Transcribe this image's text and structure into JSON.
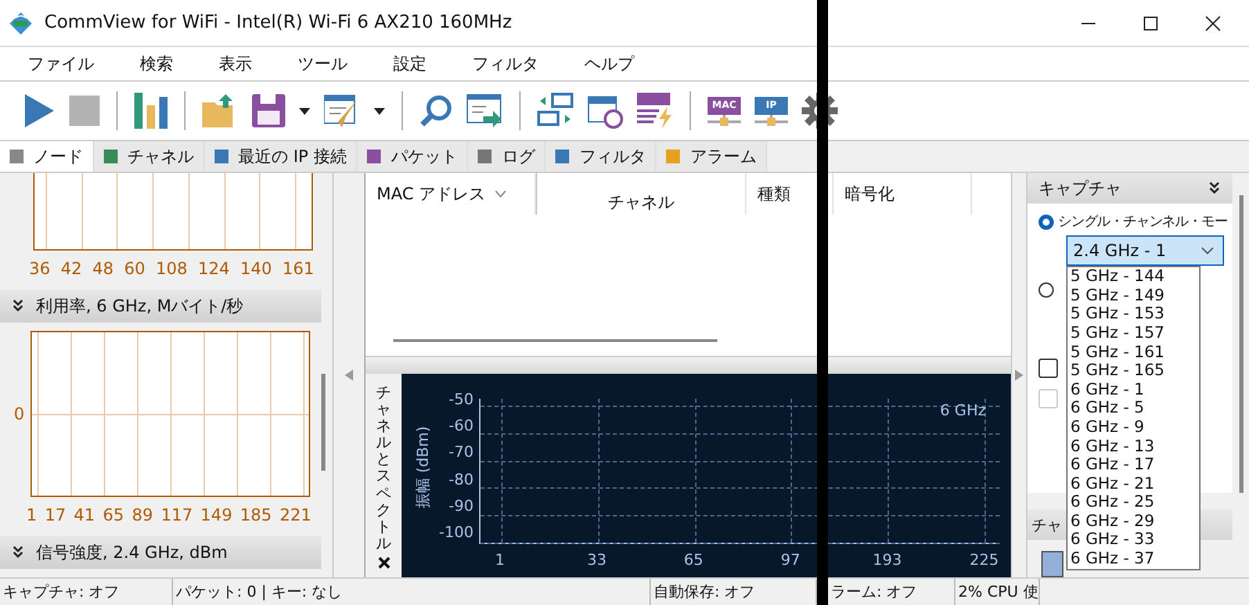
{
  "window": {
    "title": "CommView for WiFi - Intel(R) Wi-Fi 6 AX210 160MHz"
  },
  "menu": [
    "ファイル",
    "検索",
    "表示",
    "ツール",
    "設定",
    "フィルタ",
    "ヘルプ"
  ],
  "toolbar": {
    "mac_label": "MAC",
    "ip_label": "IP"
  },
  "tabs": [
    {
      "label": "ノード",
      "selected": true
    },
    {
      "label": "チャネル",
      "selected": false
    },
    {
      "label": "最近の IP 接続",
      "selected": false
    },
    {
      "label": "パケット",
      "selected": false
    },
    {
      "label": "ログ",
      "selected": false
    },
    {
      "label": "フィルタ",
      "selected": false
    },
    {
      "label": "アラーム",
      "selected": false
    }
  ],
  "left_panel": {
    "top_chart": {
      "x_ticks": [
        "36",
        "42",
        "48",
        "60",
        "108",
        "124",
        "140",
        "161"
      ]
    },
    "sections": [
      {
        "title": "利用率, 6 GHz, Mバイト/秒",
        "y_tick": "0",
        "x_ticks": [
          "1",
          "17",
          "41",
          "65",
          "89",
          "117",
          "149",
          "185",
          "221"
        ]
      },
      {
        "title": "信号強度, 2.4 GHz, dBm"
      }
    ]
  },
  "nodes_table": {
    "columns": [
      {
        "label": "MAC アドレス",
        "sorted": true
      },
      {
        "label": "チャネル",
        "sorted": false
      },
      {
        "label": "種類",
        "sorted": false
      },
      {
        "label": "暗号化",
        "sorted": false
      }
    ]
  },
  "spectrum": {
    "panel_title": "チャネルとスペクトル",
    "ylabel": "振幅 (dBm)",
    "y_ticks": [
      "-50",
      "-60",
      "-70",
      "-80",
      "-90",
      "-100"
    ],
    "x_ticks": [
      "1",
      "33",
      "65",
      "97",
      "193",
      "225"
    ],
    "band_label": "6 GHz"
  },
  "capture_panel": {
    "title": "キャプチャ",
    "modes": [
      {
        "label": "シングル・チャンネル・モー",
        "selected": true
      },
      {
        "selected": false
      }
    ],
    "channel_select": {
      "value": "2.4 GHz - 1",
      "expanded": true,
      "options": [
        "5 GHz - 144",
        "5 GHz - 149",
        "5 GHz - 153",
        "5 GHz - 157",
        "5 GHz - 161",
        "5 GHz - 165",
        "6 GHz - 1",
        "6 GHz - 5",
        "6 GHz - 9",
        "6 GHz - 13",
        "6 GHz - 17",
        "6 GHz - 21",
        "6 GHz - 25",
        "6 GHz - 29",
        "6 GHz - 33",
        "6 GHz - 37"
      ]
    },
    "checkboxes": [
      {
        "checked": false,
        "disabled": false
      },
      {
        "checked": false,
        "disabled": true
      }
    ],
    "next_section_title": "チャ"
  },
  "status_bar": [
    "キャプチャ: オフ",
    "パケット: 0 | キー: なし",
    "自動保存: オフ",
    "ラーム: オフ",
    "2% CPU 使"
  ]
}
